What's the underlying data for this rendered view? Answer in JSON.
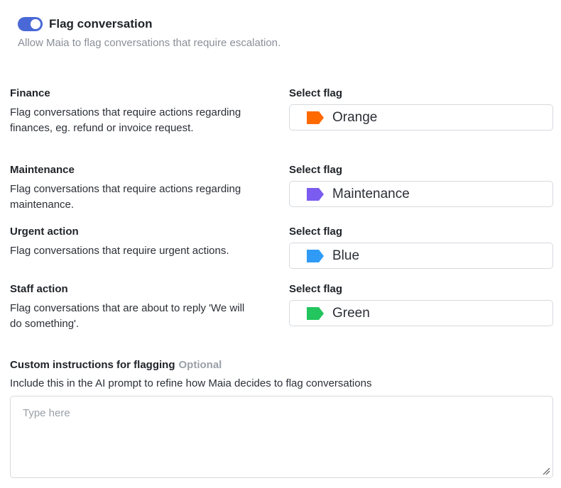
{
  "toggle": {
    "title": "Flag conversation",
    "description": "Allow Maia to flag conversations that require escalation.",
    "enabled": true,
    "color": "#4a69d6"
  },
  "categories": [
    {
      "label": "Finance",
      "description": "Flag conversations that require actions regarding finances, eg. refund or invoice request.",
      "select_label": "Select flag",
      "flag": {
        "name": "Orange",
        "color": "#ff6a00",
        "icon": "flag-tag-icon"
      }
    },
    {
      "label": "Maintenance",
      "description": "Flag conversations that require actions regarding maintenance.",
      "select_label": "Select flag",
      "flag": {
        "name": "Maintenance",
        "color": "#7b5cf0",
        "icon": "flag-tag-icon"
      }
    },
    {
      "label": "Urgent action",
      "description": "Flag conversations that require urgent actions.",
      "select_label": "Select flag",
      "flag": {
        "name": "Blue",
        "color": "#2f9bf7",
        "icon": "flag-tag-icon"
      }
    },
    {
      "label": "Staff action",
      "description": "Flag conversations that are about to reply 'We will do something'.",
      "select_label": "Select flag",
      "flag": {
        "name": "Green",
        "color": "#22c55e",
        "icon": "flag-tag-icon"
      }
    }
  ],
  "custom": {
    "label": "Custom instructions for flagging",
    "optional": "Optional",
    "description": "Include this in the AI prompt to refine how Maia decides to flag conversations",
    "placeholder": "Type here",
    "value": ""
  }
}
